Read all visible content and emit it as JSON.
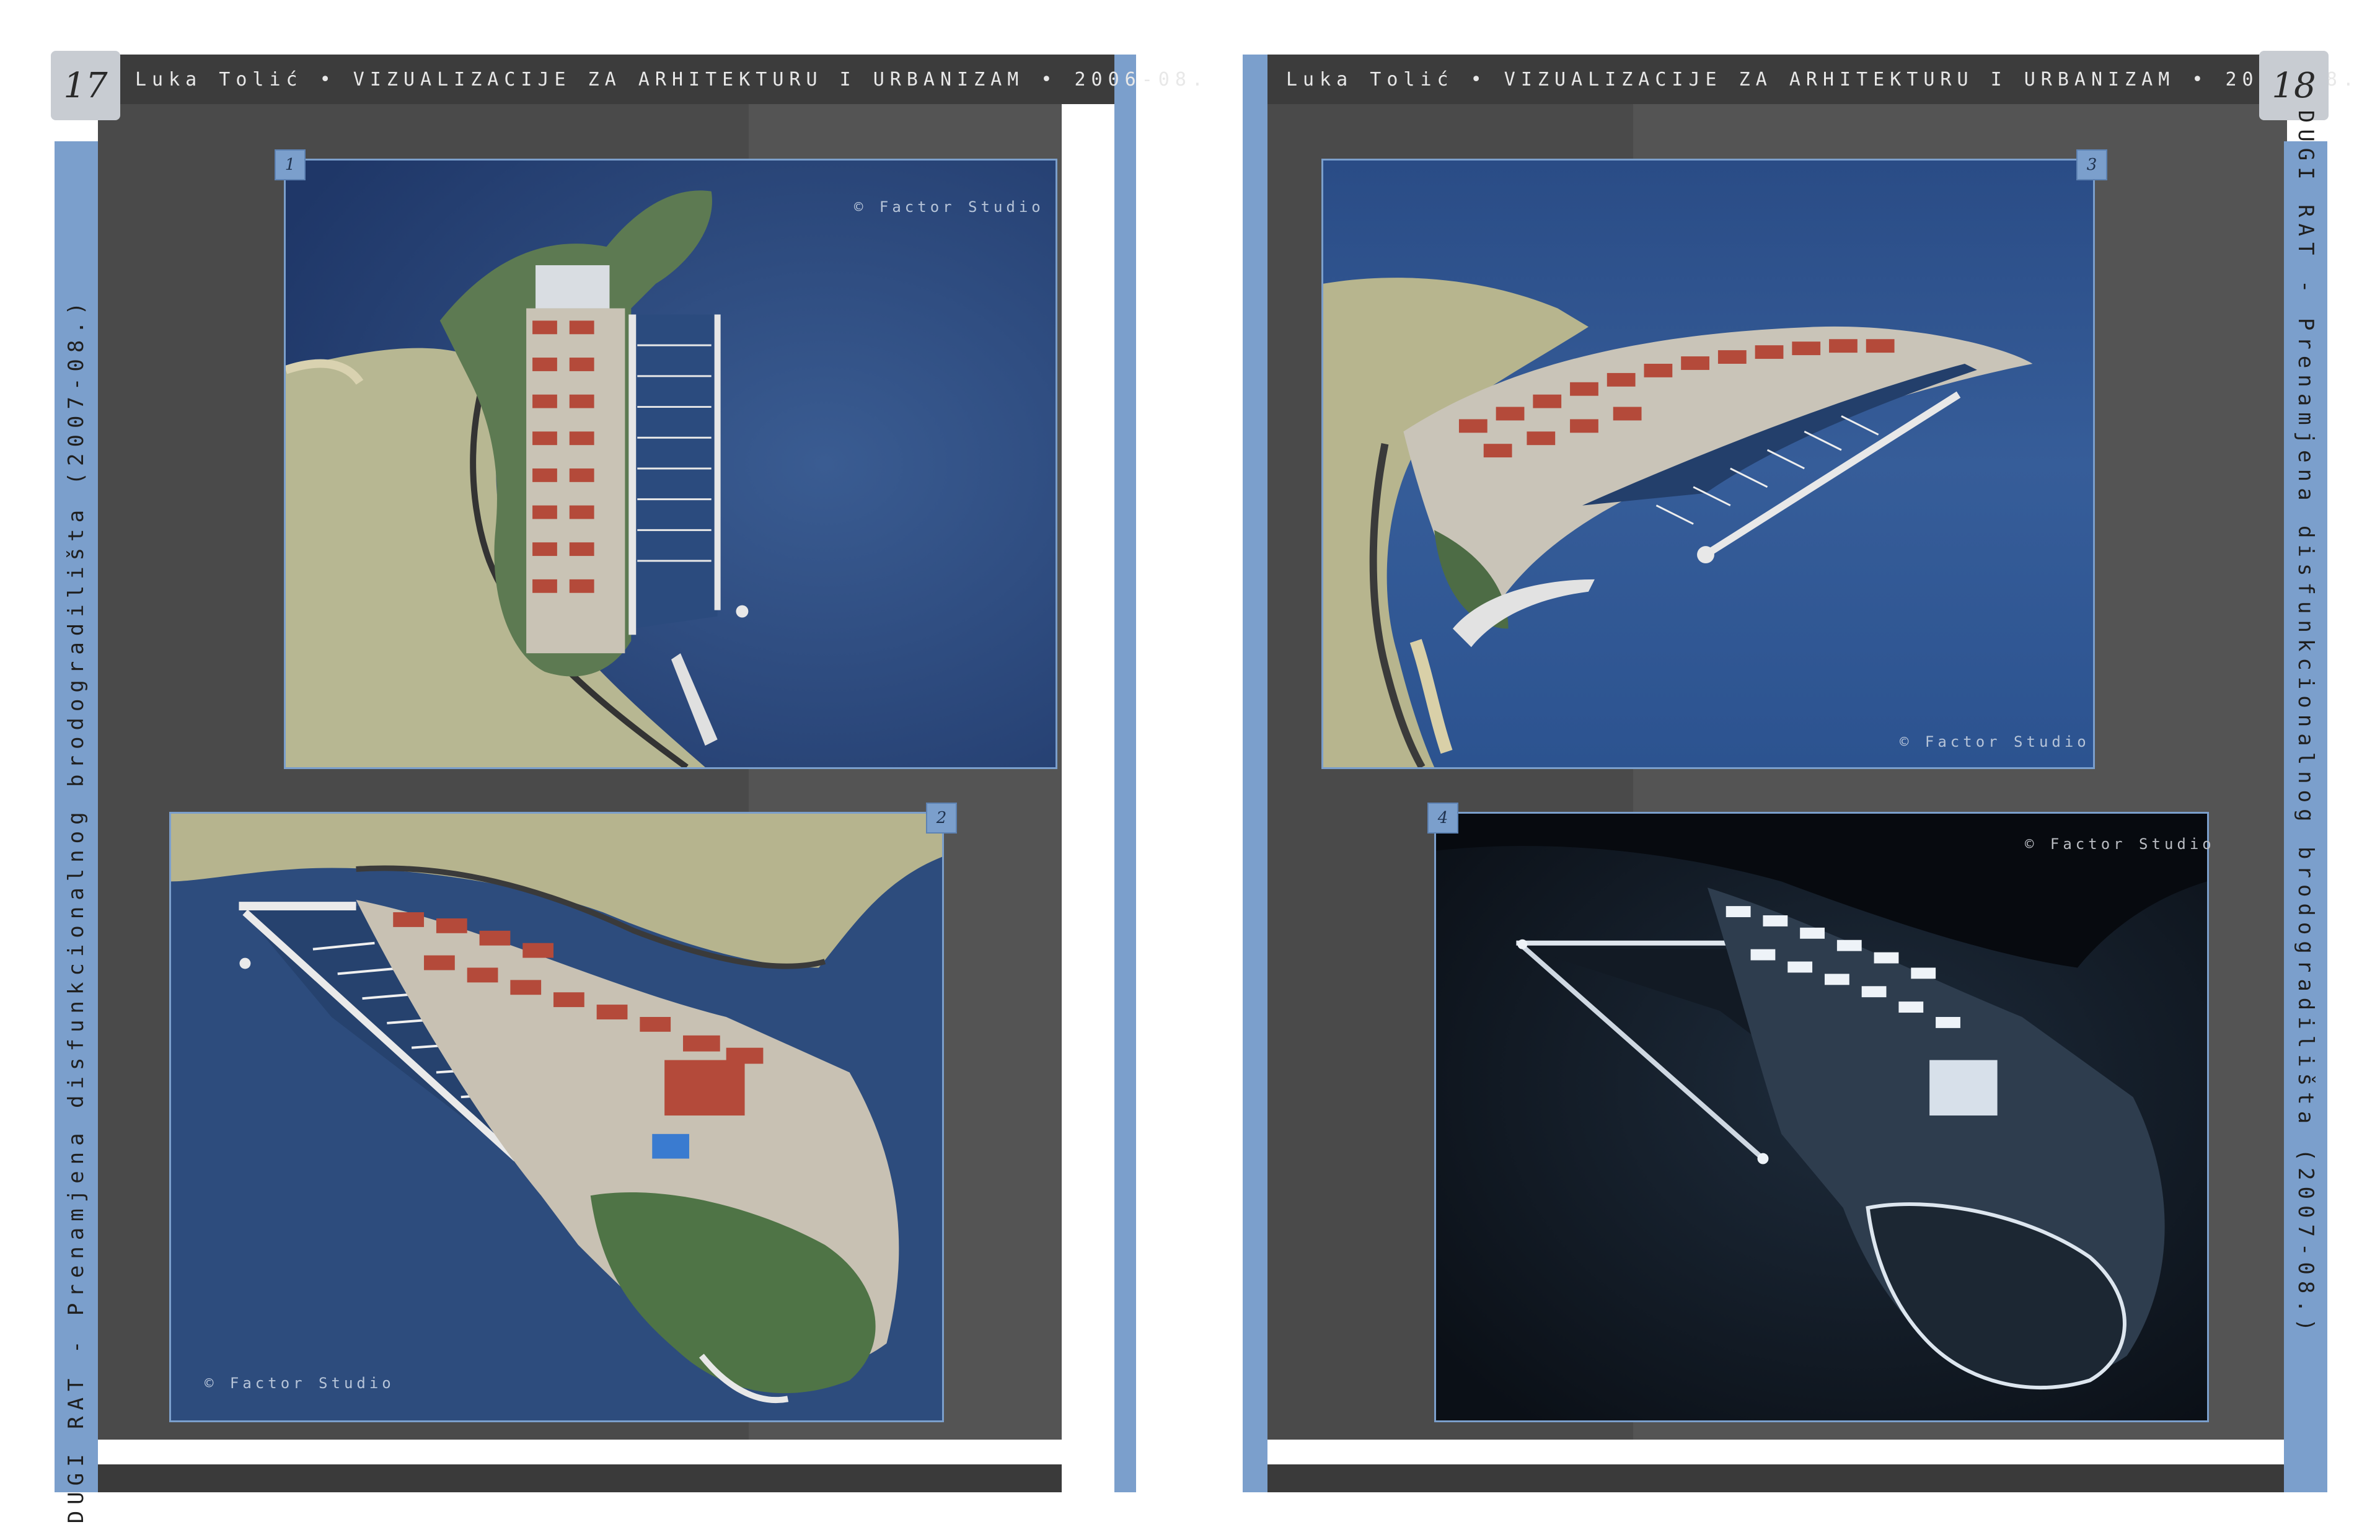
{
  "header": {
    "text": "Luka Tolić • VIZUALIZACIJE ZA ARHITEKTURU I URBANIZAM • 2006-08."
  },
  "spine": {
    "text": "DUGI RAT - Prenamjena disfunkcionalnog brodogradilišta   (2007-08.)"
  },
  "pages": [
    {
      "number": "17"
    },
    {
      "number": "18"
    }
  ],
  "figures": [
    {
      "badge": "1",
      "credit": "© Factor Studio",
      "scene": "aerial plan view of marina peninsula"
    },
    {
      "badge": "2",
      "credit": "© Factor Studio",
      "scene": "oblique aerial view from sea"
    },
    {
      "badge": "3",
      "credit": "© Factor Studio",
      "scene": "oblique aerial view of marina"
    },
    {
      "badge": "4",
      "credit": "© Factor Studio",
      "scene": "night render"
    }
  ],
  "colors": {
    "accent_blue": "#7b9fcc",
    "panel_gray": "#4a4a4a",
    "header_dark": "#3c3c3c",
    "sea_blue": "#2f4f82",
    "land_green": "#b4b48c",
    "roof_red": "#b44a3a"
  }
}
